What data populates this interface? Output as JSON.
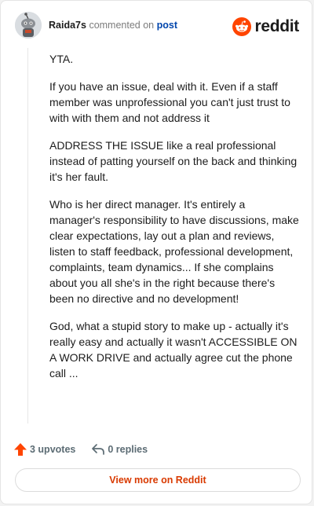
{
  "header": {
    "username": "Raida7s",
    "action_text": "commented on",
    "target_link": "post",
    "brand_name": "reddit"
  },
  "comment": {
    "paragraphs": [
      "YTA.",
      "If you have an issue, deal with it. Even if a staff member was unprofessional you can't just trust to with with them and not address it",
      "ADDRESS THE ISSUE like a real professional instead of patting yourself on the back and thinking it's her fault.",
      "Who is her direct manager. It's entirely a manager's responsibility to have discussions, make clear expectations, lay out a plan and reviews, listen to staff feedback, professional development, complaints, team dynamics... If she complains about you all she's in the right because there's been no directive and no development!",
      "God, what a stupid story to make up - actually it's really easy and actually it wasn't ACCESSIBLE ON A WORK DRIVE and actually agree cut the phone call ..."
    ]
  },
  "actions": {
    "upvotes_label": "3 upvotes",
    "replies_label": "0 replies"
  },
  "view_more_label": "View more on Reddit",
  "icons": {
    "avatar": "snoo-avatar",
    "brand": "reddit-logo-icon",
    "upvote": "upvote-arrow-icon",
    "reply": "reply-icon"
  },
  "colors": {
    "brand": "#ff4500",
    "upvote": "#ff4500",
    "link": "#0045ac",
    "view_more_text": "#d93a00"
  }
}
